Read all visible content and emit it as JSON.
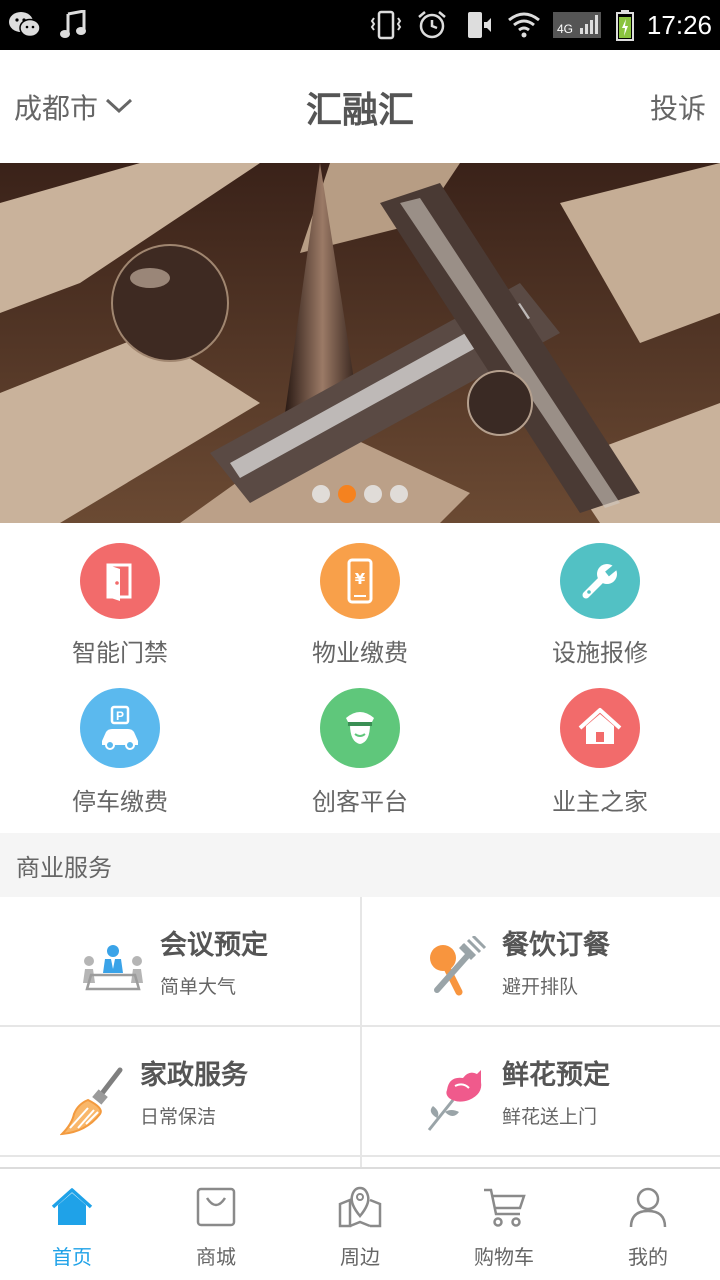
{
  "status_bar": {
    "time": "17:26",
    "network": "4G",
    "icons": [
      "wechat-icon",
      "music-icon",
      "vibrate-icon",
      "alarm-icon",
      "silent-phone-icon",
      "wifi-icon",
      "signal-icon",
      "battery-icon"
    ]
  },
  "header": {
    "city": "成都市",
    "title": "汇融汇",
    "complaint": "投诉"
  },
  "banner": {
    "slide_count": 4,
    "active_index": 1
  },
  "quick_actions": [
    {
      "label": "智能门禁",
      "icon": "door-icon",
      "color": "#f26b6b"
    },
    {
      "label": "物业缴费",
      "icon": "phone-payment-icon",
      "color": "#f8a04a"
    },
    {
      "label": "设施报修",
      "icon": "wrench-icon",
      "color": "#52c1c4"
    },
    {
      "label": "停车缴费",
      "icon": "parking-car-icon",
      "color": "#5bb9ee"
    },
    {
      "label": "创客平台",
      "icon": "officer-icon",
      "color": "#5fc77b"
    },
    {
      "label": "业主之家",
      "icon": "home-icon",
      "color": "#f26b6b"
    }
  ],
  "section": {
    "title": "商业服务"
  },
  "services": [
    {
      "title": "会议预定",
      "subtitle": "简单大气",
      "icon": "meeting-icon"
    },
    {
      "title": "餐饮订餐",
      "subtitle": "避开排队",
      "icon": "dining-icon"
    },
    {
      "title": "家政服务",
      "subtitle": "日常保洁",
      "icon": "broom-icon"
    },
    {
      "title": "鲜花预定",
      "subtitle": "鲜花送上门",
      "icon": "rose-icon"
    }
  ],
  "bottom_nav": [
    {
      "label": "首页",
      "icon": "home-nav-icon",
      "active": true
    },
    {
      "label": "商城",
      "icon": "shopping-bag-icon",
      "active": false
    },
    {
      "label": "周边",
      "icon": "map-pin-icon",
      "active": false
    },
    {
      "label": "购物车",
      "icon": "cart-icon",
      "active": false
    },
    {
      "label": "我的",
      "icon": "user-icon",
      "active": false
    }
  ],
  "colors": {
    "accent": "#1fa2e8",
    "dot_active": "#f5821f"
  }
}
